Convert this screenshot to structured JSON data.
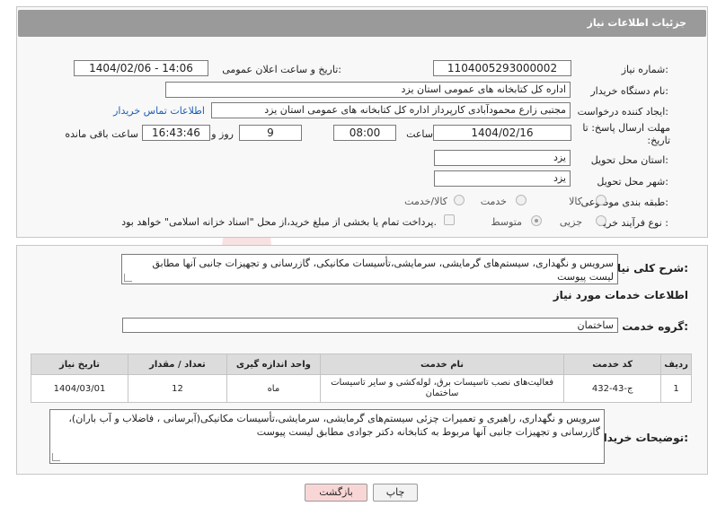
{
  "header": {
    "title": "جزئیات اطلاعات نیاز"
  },
  "form": {
    "need_number_label": "شماره نیاز:",
    "need_number": "1104005293000002",
    "announce_label": "تاریخ و ساعت اعلان عمومی:",
    "announce_value": "1404/02/06 - 14:06",
    "buyer_org_label": "نام دستگاه خریدار:",
    "buyer_org": "اداره کل کتابخانه های عمومی استان یزد",
    "creator_label": "ایجاد کننده درخواست:",
    "creator": "مجتبی زارع محمودآبادی کارپرداز اداره کل کتابخانه های عمومی استان یزد",
    "contact_link": "اطلاعات تماس خریدار",
    "deadline_label": "مهلت ارسال پاسخ: تا تاریخ:",
    "deadline_date": "1404/02/16",
    "time_label": "ساعت",
    "deadline_time": "08:00",
    "days_value": "9",
    "days_label": "روز و",
    "remaining_time": "16:43:46",
    "remaining_label": "ساعت باقی مانده",
    "province_label": "استان محل تحویل:",
    "province": "یزد",
    "city_label": "شهر محل تحویل:",
    "city": "یزد",
    "category_label": "طبقه بندی موضوعی:",
    "category_options": [
      "کالا",
      "خدمت",
      "کالا/خدمت"
    ],
    "process_label": "نوع فرآیند خرید :",
    "process_options": [
      "جزیی",
      "متوسط"
    ],
    "payment_note": "پرداخت تمام یا بخشی از مبلغ خرید،از محل \"اسناد خزانه اسلامی\" خواهد بود."
  },
  "summary": {
    "label": "شرح کلی نیاز:",
    "text": "سرویس و نگهداری، سیستم‌های گرمایشی، سرمایشی،تأسیسات مکانیکی، گازرسانی و تجهیزات جانبی آنها مطابق لیست پیوست"
  },
  "services": {
    "section_title": "اطلاعات خدمات مورد نیاز",
    "group_label": "گروه خدمت:",
    "group_value": "ساختمان",
    "columns": [
      "ردیف",
      "کد خدمت",
      "نام خدمت",
      "واحد اندازه گیری",
      "تعداد / مقدار",
      "تاریخ نیاز"
    ],
    "rows": [
      {
        "row": "1",
        "code": "ج-43-432",
        "name": "فعالیت‌های نصب تاسیسات برق، لوله‌کشی و سایر تاسیسات ساختمان",
        "unit": "ماه",
        "qty": "12",
        "date": "1404/03/01"
      }
    ]
  },
  "buyer_notes": {
    "label": "توضیحات خریدار:",
    "text": "سرویس و نگهداری، راهبری و تعمیرات چزئی سیستم‌های گرمایشی، سرمایشی،تأسیسات مکانیکی(آبرسانی ، فاضلاب و آب باران)، گازرسانی و تجهیزات جانبی آنها مربوط به کتابخانه دکتر جوادی مطابق لیست پیوست"
  },
  "buttons": {
    "print": "چاپ",
    "back": "بازگشت"
  },
  "watermark": {
    "text": "AriaTender.neT"
  },
  "colors": {
    "header_bg": "#9a9a9a",
    "link": "#1f5fb5",
    "back_btn": "#f9d6d6"
  }
}
